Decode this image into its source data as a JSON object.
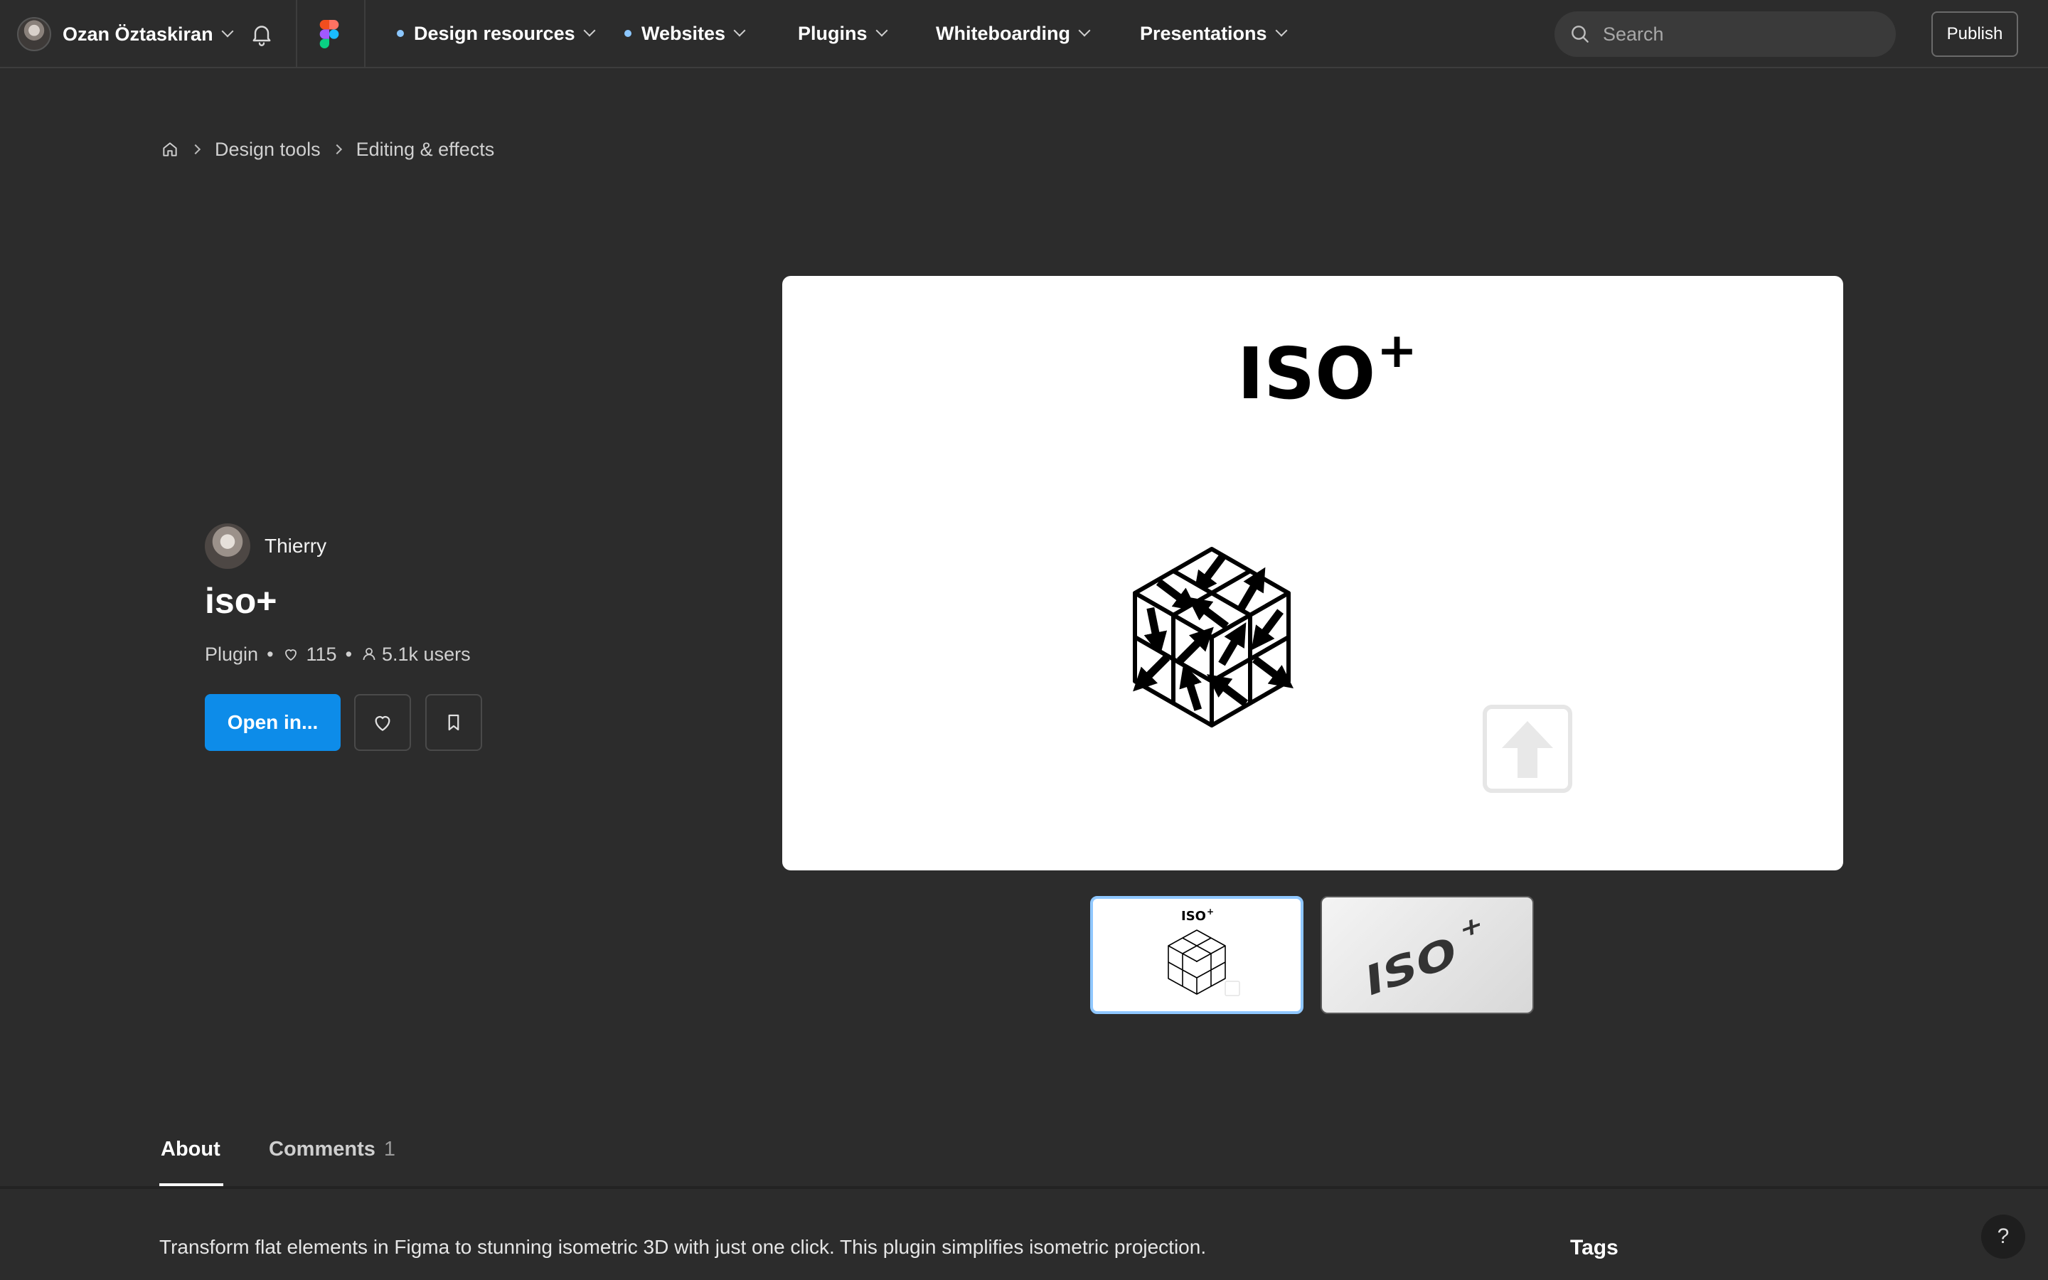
{
  "topbar": {
    "user_name": "Ozan Öztaskiran",
    "nav": [
      {
        "label": "Design resources",
        "dot": true
      },
      {
        "label": "Websites",
        "dot": true
      },
      {
        "label": "Plugins",
        "dot": false
      },
      {
        "label": "Whiteboarding",
        "dot": false
      },
      {
        "label": "Presentations",
        "dot": false
      }
    ],
    "search_placeholder": "Search",
    "publish_label": "Publish"
  },
  "breadcrumb": [
    "Design tools",
    "Editing & effects"
  ],
  "plugin": {
    "author": "Thierry",
    "title": "iso+",
    "type": "Plugin",
    "likes": "115",
    "users": "5.1k users",
    "open_label": "Open in..."
  },
  "preview": {
    "logo_text": "ISO",
    "logo_sup": "+"
  },
  "tabs": {
    "about": "About",
    "comments": "Comments",
    "comments_count": "1"
  },
  "about": {
    "description": "Transform flat elements in Figma to stunning isometric 3D with just one click. This plugin simplifies isometric projection.",
    "tags_heading": "Tags"
  },
  "help_label": "?",
  "colors": {
    "background": "#2c2c2c",
    "primary_button": "#0d8ce9",
    "nav_dot": "#8cc7ff",
    "selected_thumb_border": "#8fc7ff"
  }
}
